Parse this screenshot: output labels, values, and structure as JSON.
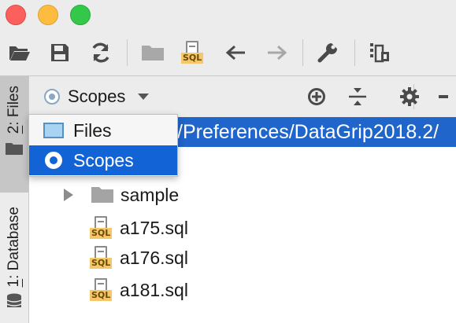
{
  "toolbar": {
    "buttons": [
      "open-icon",
      "save-icon",
      "sync-icon",
      "folder-icon",
      "sql-file-icon",
      "back-icon",
      "forward-icon",
      "wrench-icon",
      "data-source-icon"
    ]
  },
  "stripe": {
    "files_tab": {
      "mnemonic": "2",
      "label": ": Files"
    },
    "database_tab": {
      "mnemonic": "1",
      "label": ": Database"
    }
  },
  "panel_header": {
    "scope_label": "Scopes",
    "actions": [
      "locate-icon",
      "collapse-all-icon",
      "settings-icon",
      "hide-icon"
    ]
  },
  "tree": {
    "path_text": "/Preferences/DataGrip2018.2/",
    "folder": {
      "label": "sample"
    },
    "files": [
      {
        "label": "a175.sql",
        "badge": "SQL"
      },
      {
        "label": "a176.sql",
        "badge": "SQL"
      },
      {
        "label": "a181.sql",
        "badge": "SQL"
      }
    ]
  },
  "popup": {
    "items": [
      {
        "label": "Files",
        "selected": false
      },
      {
        "label": "Scopes",
        "selected": true
      }
    ]
  },
  "toolbar_sql_badge": "SQL",
  "colors": {
    "selection": "#2065c9",
    "popup_selection": "#1163d6",
    "sql_badge": "#f5c76b"
  }
}
